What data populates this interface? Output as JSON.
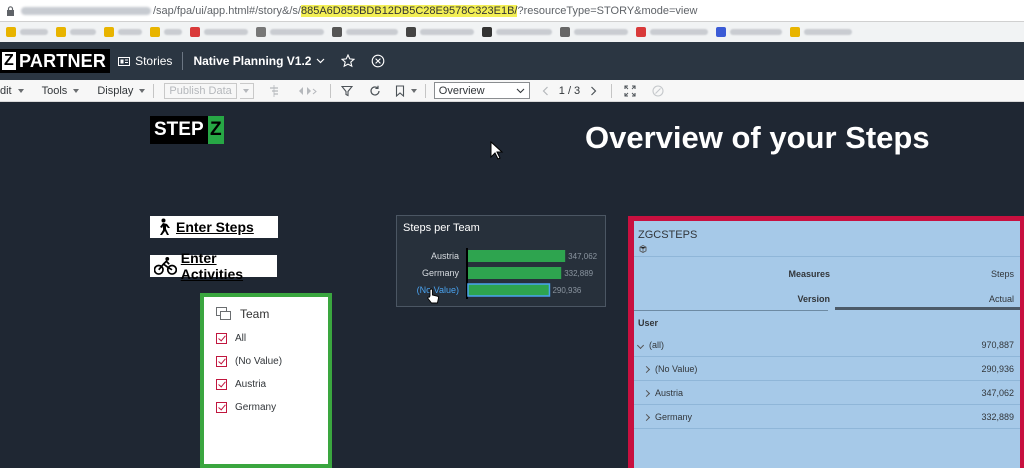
{
  "browser": {
    "url_prefix": "/sap/fpa/ui/app.html#/story&/s/",
    "url_highlight": "885A6D855BDB12DB5C28E9578C323E1B/",
    "url_suffix": "?resourceType=STORY&mode=view"
  },
  "shell": {
    "logo_z": "Z",
    "logo_text": "PARTNER",
    "stories_label": "Stories",
    "story_title": "Native Planning V1.2"
  },
  "toolbar": {
    "edit_label": "dit",
    "tools_label": "Tools",
    "display_label": "Display",
    "publish_label": "Publish Data",
    "page_select_value": "Overview",
    "page_indicator": "1 / 3"
  },
  "canvas": {
    "stepz_step": "STEP",
    "stepz_z": "Z",
    "title": "Overview of your Steps",
    "enter_steps": "Enter Steps",
    "enter_activities": "Enter Activities"
  },
  "filter": {
    "header": "Team",
    "items": [
      "All",
      "(No Value)",
      "Austria",
      "Germany"
    ]
  },
  "chart_data": {
    "type": "bar",
    "title": "Steps per Team",
    "categories": [
      "Austria",
      "Germany",
      "(No Value)"
    ],
    "values": [
      347062,
      332889,
      290936
    ],
    "value_labels": [
      "347,062",
      "332,889",
      "290,936"
    ],
    "xlim": [
      0,
      400000
    ],
    "bar_color": "#2ea44f"
  },
  "table": {
    "title": "ZGCSTEPS",
    "measures_label": "Measures",
    "measures_value": "Steps",
    "version_label": "Version",
    "version_value": "Actual",
    "dimension_label": "User",
    "rows": [
      {
        "label": "(all)",
        "value": "970,887",
        "expand": "down"
      },
      {
        "label": "(No Value)",
        "value": "290,936",
        "expand": "right"
      },
      {
        "label": "Austria",
        "value": "347,062",
        "expand": "right"
      },
      {
        "label": "Germany",
        "value": "332,889",
        "expand": "right"
      }
    ]
  }
}
